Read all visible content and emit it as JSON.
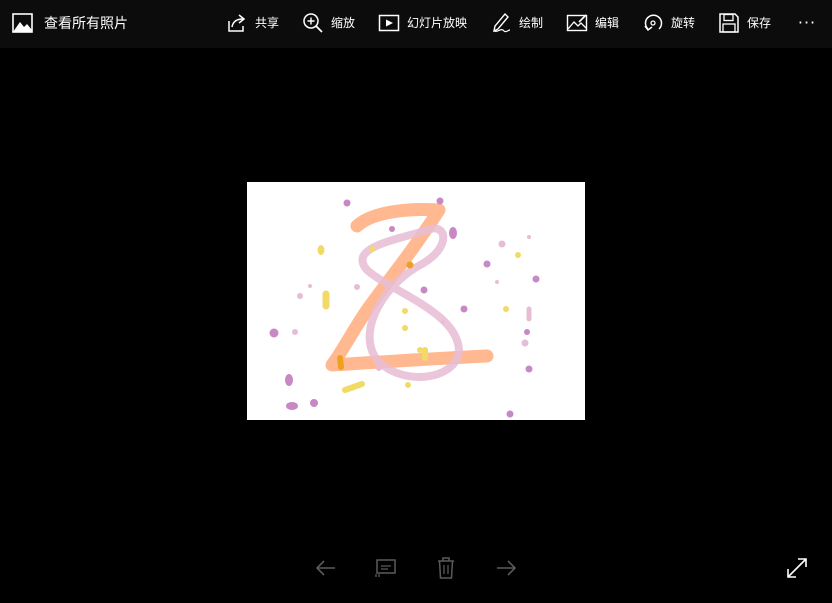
{
  "app": {
    "title": "查看所有照片",
    "icon": "photos-app-icon"
  },
  "toolbar": {
    "share_label": "共享",
    "zoom_label": "缩放",
    "slideshow_label": "幻灯片放映",
    "draw_label": "绘制",
    "edit_label": "编辑",
    "rotate_label": "旋转",
    "save_label": "保存",
    "more_label": "···"
  },
  "bottom_bar": {
    "previous": "arrow-left-icon",
    "compare": "compare-icon",
    "delete": "trash-icon",
    "next": "arrow-right-icon",
    "fullscreen": "expand-icon"
  },
  "colors": {
    "background": "#000000",
    "toolbar": "#0c0c0c",
    "text": "#ffffff",
    "disabled": "#5a5a5a",
    "stroke_orange": "#ffb083",
    "stroke_pink": "#e8bcd5",
    "dot_purple": "#c888c6",
    "dot_yellow": "#f2da66"
  }
}
